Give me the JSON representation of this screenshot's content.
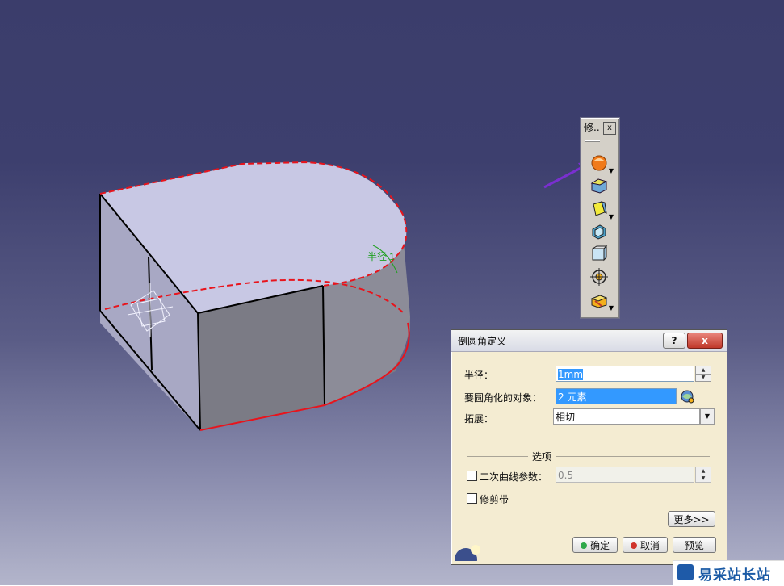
{
  "viewer": {
    "radius_tag": "半径",
    "radius_tag_num": "1"
  },
  "toolbar": {
    "title": "修..",
    "close": "x",
    "tools": [
      "edge-fillet-icon",
      "chamfer-icon",
      "draft-icon",
      "shell-icon",
      "thickness-icon",
      "thread-icon",
      "remove-face-icon"
    ]
  },
  "dialog": {
    "title": "倒圆角定义",
    "help": "?",
    "close": "x",
    "radius_label": "半径：",
    "radius_value": "1mm",
    "objects_label": "要圆角化的对象：",
    "objects_value": "2 元素",
    "propagation_label": "拓展：",
    "propagation_value": "相切",
    "options_label": "选项",
    "conic_label": "二次曲线参数：",
    "conic_value": "0.5",
    "trim_label": "修剪带",
    "more_button": "更多>>",
    "ok_button": "确定",
    "cancel_button": "取消",
    "preview_button": "预览"
  },
  "watermark": {
    "text": "易采站长站"
  },
  "colors": {
    "background_top": "#3b3d6b",
    "face_top": "#c9c9e6",
    "edge_highlight": "#e8141c",
    "annotation": "#1fa01f",
    "arrow": "#7a2fd0"
  }
}
